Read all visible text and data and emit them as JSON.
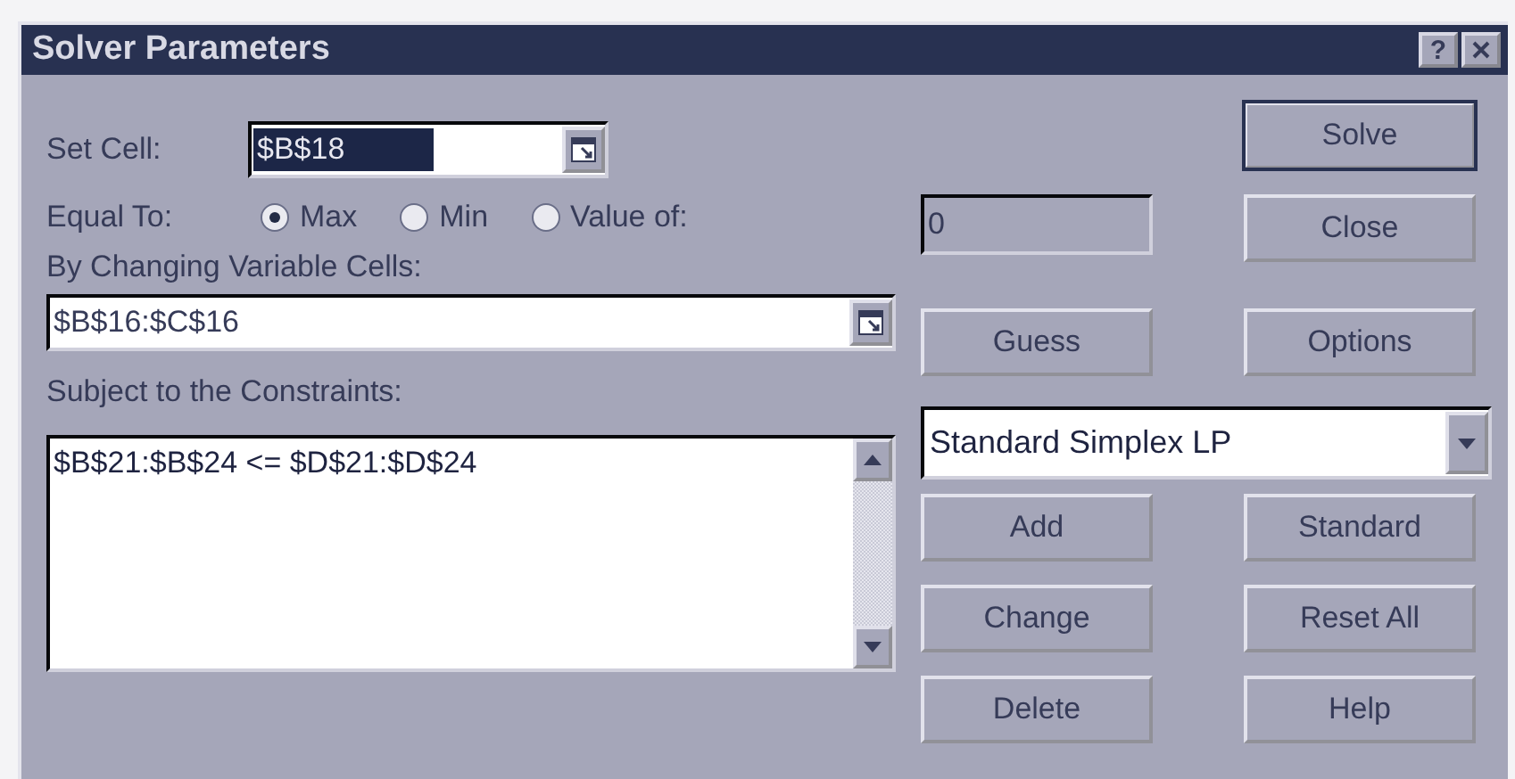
{
  "window": {
    "title": "Solver Parameters",
    "help_button": "?"
  },
  "set_cell": {
    "label": "Set Cell:",
    "value": "$B$18",
    "text_selected": true
  },
  "equal_to": {
    "label": "Equal To:",
    "options": [
      {
        "label": "Max",
        "selected": true
      },
      {
        "label": "Min",
        "selected": false
      },
      {
        "label": "Value of:",
        "selected": false
      }
    ],
    "value_field": {
      "value": "0",
      "disabled": true
    }
  },
  "changing_cells": {
    "label": "By Changing Variable Cells:",
    "value": "$B$16:$C$16"
  },
  "constraints": {
    "label": "Subject to the Constraints:",
    "items": [
      "$B$21:$B$24 <= $D$21:$D$24"
    ]
  },
  "solving_method": {
    "value": "Standard Simplex LP"
  },
  "actions": {
    "solve": {
      "label": "Solve",
      "default": true
    },
    "close": {
      "label": "Close",
      "default": false
    },
    "guess": {
      "label": "Guess",
      "default": false
    },
    "options": {
      "label": "Options",
      "default": false
    },
    "add": {
      "label": "Add",
      "default": false
    },
    "standard": {
      "label": "Standard",
      "default": false
    },
    "change": {
      "label": "Change",
      "default": false
    },
    "reset_all": {
      "label": "Reset All",
      "default": false
    },
    "delete": {
      "label": "Delete",
      "default": false
    },
    "help": {
      "label": "Help",
      "default": false
    }
  }
}
